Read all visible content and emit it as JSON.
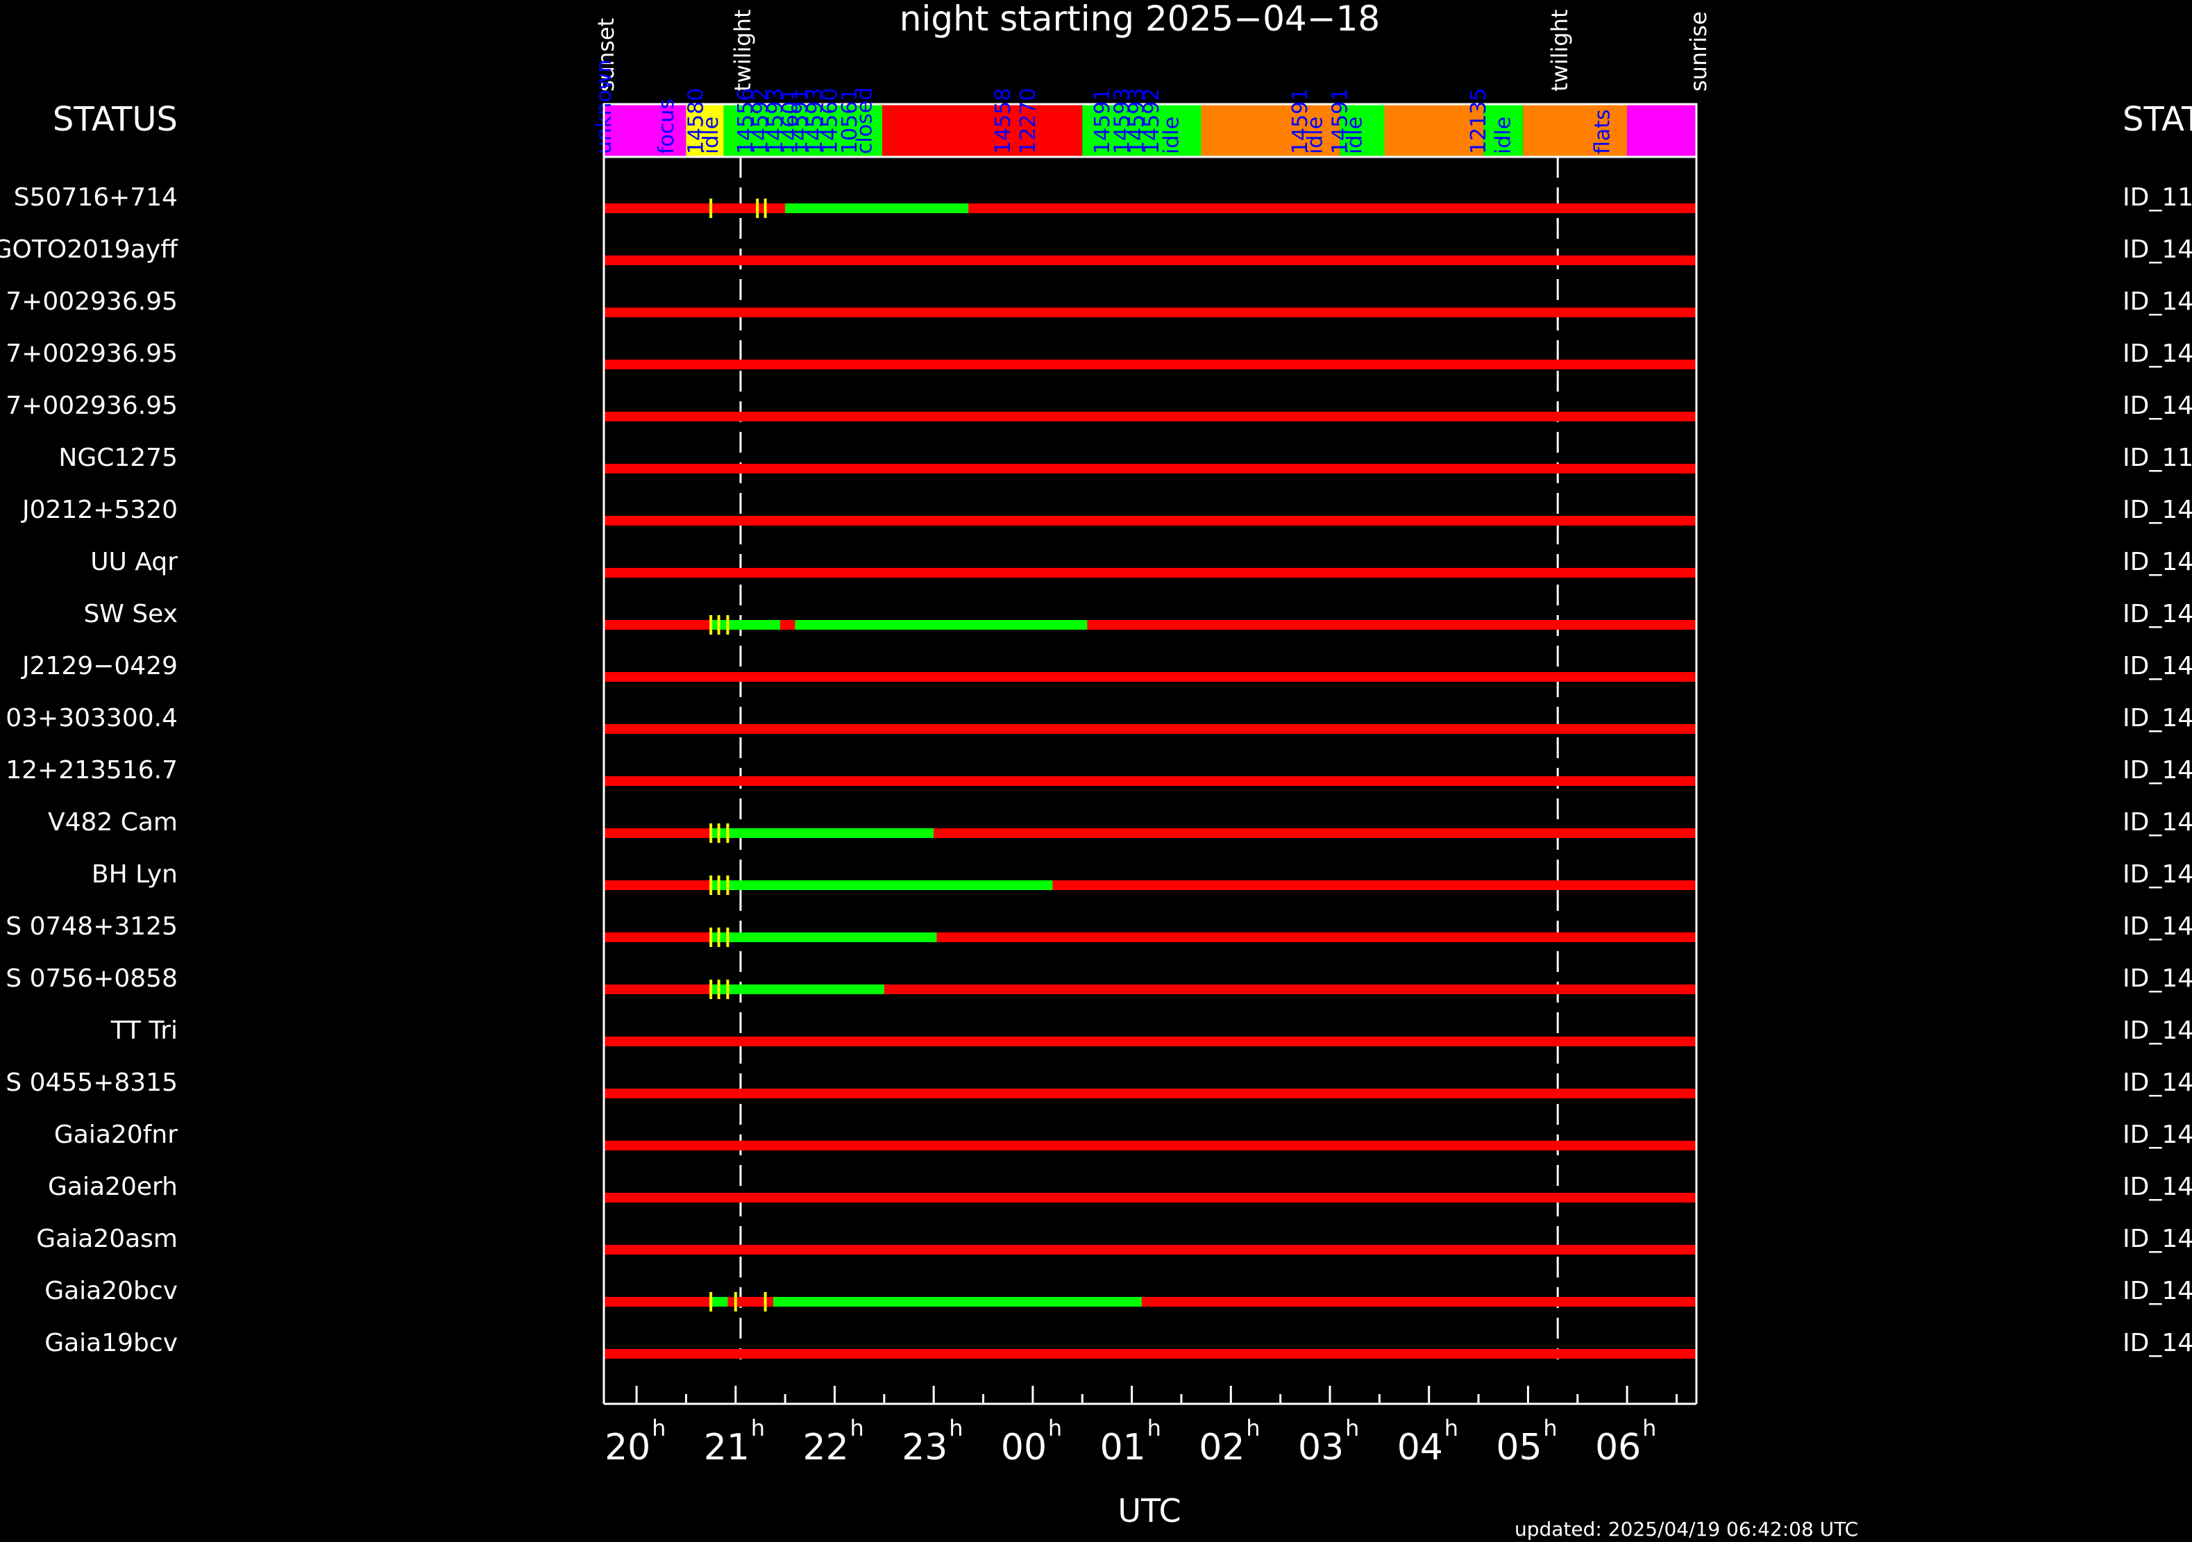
{
  "title": "night starting 2025−04−18",
  "status_label_left": "STATUS",
  "status_label_right": "STAT",
  "xlabel": "UTC",
  "updated": "updated: 2025/04/19 06:42:08 UTC",
  "colors": {
    "red": "#ff0000",
    "green": "#00ff00",
    "yellow": "#ffff00",
    "orange": "#ff8000",
    "magenta": "#ff00ff",
    "blue": "#0000ff",
    "white": "#ffffff"
  },
  "chart_data": {
    "type": "timeline",
    "x_range": [
      19.67,
      30.7
    ],
    "x_unit": "hours UTC (values above 24 are next morning)",
    "ticks": [
      {
        "v": 20,
        "label": "20",
        "sup": "h"
      },
      {
        "v": 21,
        "label": "21",
        "sup": "h"
      },
      {
        "v": 22,
        "label": "22",
        "sup": "h"
      },
      {
        "v": 23,
        "label": "23",
        "sup": "h"
      },
      {
        "v": 24,
        "label": "00",
        "sup": "h"
      },
      {
        "v": 25,
        "label": "01",
        "sup": "h"
      },
      {
        "v": 26,
        "label": "02",
        "sup": "h"
      },
      {
        "v": 27,
        "label": "03",
        "sup": "h"
      },
      {
        "v": 28,
        "label": "04",
        "sup": "h"
      },
      {
        "v": 29,
        "label": "05",
        "sup": "h"
      },
      {
        "v": 30,
        "label": "06",
        "sup": "h"
      }
    ],
    "events": [
      {
        "label": "sunset",
        "t": 19.67,
        "dashed": false
      },
      {
        "label": "twilight",
        "t": 21.05,
        "dashed": true
      },
      {
        "label": "twilight",
        "t": 29.3,
        "dashed": true
      },
      {
        "label": "sunrise",
        "t": 30.7,
        "dashed": false
      }
    ],
    "status_bar": {
      "segments": [
        {
          "t0": 19.67,
          "t1": 20.5,
          "color": "magenta"
        },
        {
          "t0": 20.5,
          "t1": 20.65,
          "color": "yellow"
        },
        {
          "t0": 20.65,
          "t1": 20.88,
          "color": "yellow"
        },
        {
          "t0": 20.88,
          "t1": 21.05,
          "color": "green"
        },
        {
          "t0": 21.05,
          "t1": 21.45,
          "color": "green"
        },
        {
          "t0": 21.45,
          "t1": 22.48,
          "color": "green"
        },
        {
          "t0": 22.48,
          "t1": 24.5,
          "color": "red"
        },
        {
          "t0": 24.5,
          "t1": 25.7,
          "color": "green"
        },
        {
          "t0": 25.7,
          "t1": 27.1,
          "color": "orange"
        },
        {
          "t0": 27.1,
          "t1": 27.55,
          "color": "green"
        },
        {
          "t0": 27.55,
          "t1": 28.55,
          "color": "orange"
        },
        {
          "t0": 28.55,
          "t1": 28.95,
          "color": "green"
        },
        {
          "t0": 28.95,
          "t1": 30.0,
          "color": "orange"
        },
        {
          "t0": 30.0,
          "t1": 30.7,
          "color": "magenta"
        }
      ],
      "labels": [
        {
          "t": 19.67,
          "text": "unknown"
        },
        {
          "t": 20.3,
          "text": "focus"
        },
        {
          "t": 20.6,
          "text": "14580"
        },
        {
          "t": 20.75,
          "text": "idle"
        },
        {
          "t": 21.1,
          "text": "14556"
        },
        {
          "t": 21.25,
          "text": "14592"
        },
        {
          "t": 21.4,
          "text": "14593"
        },
        {
          "t": 21.55,
          "text": "14601"
        },
        {
          "t": 21.65,
          "text": "14591"
        },
        {
          "t": 21.8,
          "text": "14593"
        },
        {
          "t": 21.95,
          "text": "14560"
        },
        {
          "t": 22.15,
          "text": "10561"
        },
        {
          "t": 22.3,
          "text": "closed"
        },
        {
          "t": 23.7,
          "text": "14558"
        },
        {
          "t": 23.95,
          "text": "12270"
        },
        {
          "t": 24.7,
          "text": "14591"
        },
        {
          "t": 24.9,
          "text": "14593"
        },
        {
          "t": 25.05,
          "text": "14593"
        },
        {
          "t": 25.2,
          "text": "14592"
        },
        {
          "t": 25.4,
          "text": "idle"
        },
        {
          "t": 26.7,
          "text": "14591"
        },
        {
          "t": 26.85,
          "text": "idle"
        },
        {
          "t": 27.1,
          "text": "14591"
        },
        {
          "t": 27.25,
          "text": "idle"
        },
        {
          "t": 28.5,
          "text": "12135"
        },
        {
          "t": 28.75,
          "text": "idle"
        },
        {
          "t": 29.75,
          "text": "flats"
        }
      ]
    },
    "rows": [
      {
        "target": "S50716+714",
        "id": "ID_11",
        "obs": [
          {
            "t0": 21.5,
            "t1": 23.35,
            "color": "green"
          }
        ],
        "marks": [
          20.75,
          21.22,
          21.3
        ]
      },
      {
        "target": "GOTO2019ayff",
        "id": "ID_14",
        "obs": [],
        "marks": []
      },
      {
        "target": "7+002936.95",
        "id": "ID_14",
        "obs": [],
        "marks": []
      },
      {
        "target": "7+002936.95",
        "id": "ID_14",
        "obs": [],
        "marks": []
      },
      {
        "target": "7+002936.95",
        "id": "ID_14",
        "obs": [],
        "marks": []
      },
      {
        "target": "NGC1275",
        "id": "ID_11",
        "obs": [],
        "marks": []
      },
      {
        "target": "J0212+5320",
        "id": "ID_14",
        "obs": [],
        "marks": []
      },
      {
        "target": "UU Aqr",
        "id": "ID_14",
        "obs": [],
        "marks": []
      },
      {
        "target": "SW Sex",
        "id": "ID_14",
        "obs": [
          {
            "t0": 20.75,
            "t1": 21.45,
            "color": "green"
          },
          {
            "t0": 21.6,
            "t1": 24.55,
            "color": "green"
          }
        ],
        "marks": [
          20.75,
          20.83,
          20.92
        ]
      },
      {
        "target": "J2129−0429",
        "id": "ID_14",
        "obs": [],
        "marks": []
      },
      {
        "target": "03+303300.4",
        "id": "ID_14",
        "obs": [],
        "marks": []
      },
      {
        "target": "12+213516.7",
        "id": "ID_14",
        "obs": [],
        "marks": []
      },
      {
        "target": "V482 Cam",
        "id": "ID_14",
        "obs": [
          {
            "t0": 20.75,
            "t1": 23.0,
            "color": "green"
          }
        ],
        "marks": [
          20.75,
          20.83,
          20.92
        ]
      },
      {
        "target": "BH Lyn",
        "id": "ID_14",
        "obs": [
          {
            "t0": 20.75,
            "t1": 24.2,
            "color": "green"
          }
        ],
        "marks": [
          20.75,
          20.83,
          20.92
        ]
      },
      {
        "target": "S 0748+3125",
        "id": "ID_14",
        "obs": [
          {
            "t0": 20.75,
            "t1": 23.03,
            "color": "green"
          }
        ],
        "marks": [
          20.75,
          20.83,
          20.92
        ]
      },
      {
        "target": "S 0756+0858",
        "id": "ID_14",
        "obs": [
          {
            "t0": 20.75,
            "t1": 22.5,
            "color": "green"
          }
        ],
        "marks": [
          20.75,
          20.83,
          20.92
        ]
      },
      {
        "target": "TT Tri",
        "id": "ID_14",
        "obs": [],
        "marks": []
      },
      {
        "target": "S 0455+8315",
        "id": "ID_14",
        "obs": [],
        "marks": []
      },
      {
        "target": "Gaia20fnr",
        "id": "ID_14",
        "obs": [],
        "marks": []
      },
      {
        "target": "Gaia20erh",
        "id": "ID_14",
        "obs": [],
        "marks": []
      },
      {
        "target": "Gaia20asm",
        "id": "ID_14",
        "obs": [],
        "marks": []
      },
      {
        "target": "Gaia20bcv",
        "id": "ID_14",
        "obs": [
          {
            "t0": 20.75,
            "t1": 20.92,
            "color": "green"
          },
          {
            "t0": 21.38,
            "t1": 25.1,
            "color": "green"
          }
        ],
        "marks": [
          20.75,
          21.0,
          21.3
        ]
      },
      {
        "target": "Gaia19bcv",
        "id": "ID_14",
        "obs": [],
        "marks": []
      }
    ]
  }
}
